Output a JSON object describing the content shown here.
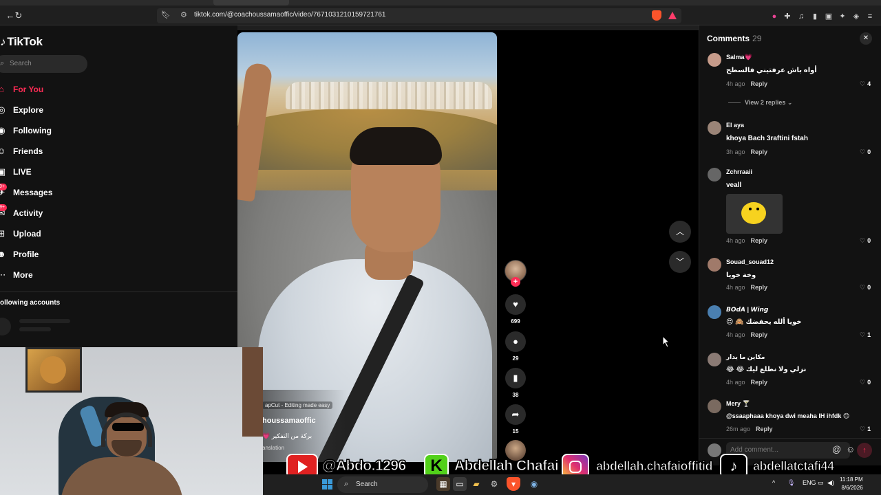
{
  "browser": {
    "url": "tiktok.com/@coachoussamaoffic/video/7671031210159721761"
  },
  "sidebar": {
    "logo_text": "TikTok",
    "search_placeholder": "Search",
    "nav": [
      {
        "label": "For You",
        "icon": "home-icon",
        "active": true
      },
      {
        "label": "Explore",
        "icon": "compass-icon"
      },
      {
        "label": "Following",
        "icon": "following-icon"
      },
      {
        "label": "Friends",
        "icon": "friends-icon"
      },
      {
        "label": "LIVE",
        "icon": "live-icon"
      },
      {
        "label": "Messages",
        "icon": "messages-icon",
        "badge": "9+"
      },
      {
        "label": "Activity",
        "icon": "activity-icon",
        "badge": "9+"
      },
      {
        "label": "Upload",
        "icon": "upload-icon"
      },
      {
        "label": "Profile",
        "icon": "profile-icon"
      },
      {
        "label": "More",
        "icon": "more-icon"
      }
    ],
    "following_accounts_title": "ollowing accounts"
  },
  "video": {
    "capcut_tag": "apCut - Editing made easy",
    "author": "houssamaoffic",
    "caption": "بركة من التفكير 💗",
    "translation": "anslation"
  },
  "actions": {
    "likes": "699",
    "comments": "29",
    "saves": "38",
    "shares": "15"
  },
  "comments_panel": {
    "title": "Comments",
    "count": "29",
    "view_replies": "View 2 replies",
    "reply_label": "Reply",
    "input_placeholder": "Add comment...",
    "items": [
      {
        "name": "Salma💗",
        "text": "أواه باش عرفتيني فالسطح",
        "time": "4h ago",
        "likes": "4"
      },
      {
        "name": "El aya",
        "text": "khoya Bach 3raftini fstah",
        "time": "3h ago",
        "likes": "0"
      },
      {
        "name": "Zchrraaii",
        "text": "veall",
        "time": "4h ago",
        "likes": "0"
      },
      {
        "name": "Souad_souad12",
        "text": "وخة خويا",
        "time": "4h ago",
        "likes": "0"
      },
      {
        "name": "𝘽𝙊𝙙𝘼 | 𝙒𝙞𝙣𝙜",
        "text": "خويا ألله يحفضك 🙈 😍",
        "time": "4h ago",
        "likes": "1"
      },
      {
        "name": "مكاين ما يدار",
        "text": "نزلي ولا نطلع ليك 😂 😂",
        "time": "4h ago",
        "likes": "0"
      },
      {
        "name": "Mery 🍸",
        "text": "@ssaaphaaa khoya dwi meaha lH ihfdk 😊",
        "time": "26m ago",
        "likes": "1"
      }
    ]
  },
  "banner": {
    "youtube": "@Abdo.1296",
    "kick": "Abdellah Chafai",
    "instagram": "abdellah.chafaioffitid",
    "tiktok": "abdellatctafi44"
  },
  "taskbar": {
    "search": "Search",
    "lang": "ENG",
    "time": "11:18 PM",
    "date": "8/6/2026"
  }
}
